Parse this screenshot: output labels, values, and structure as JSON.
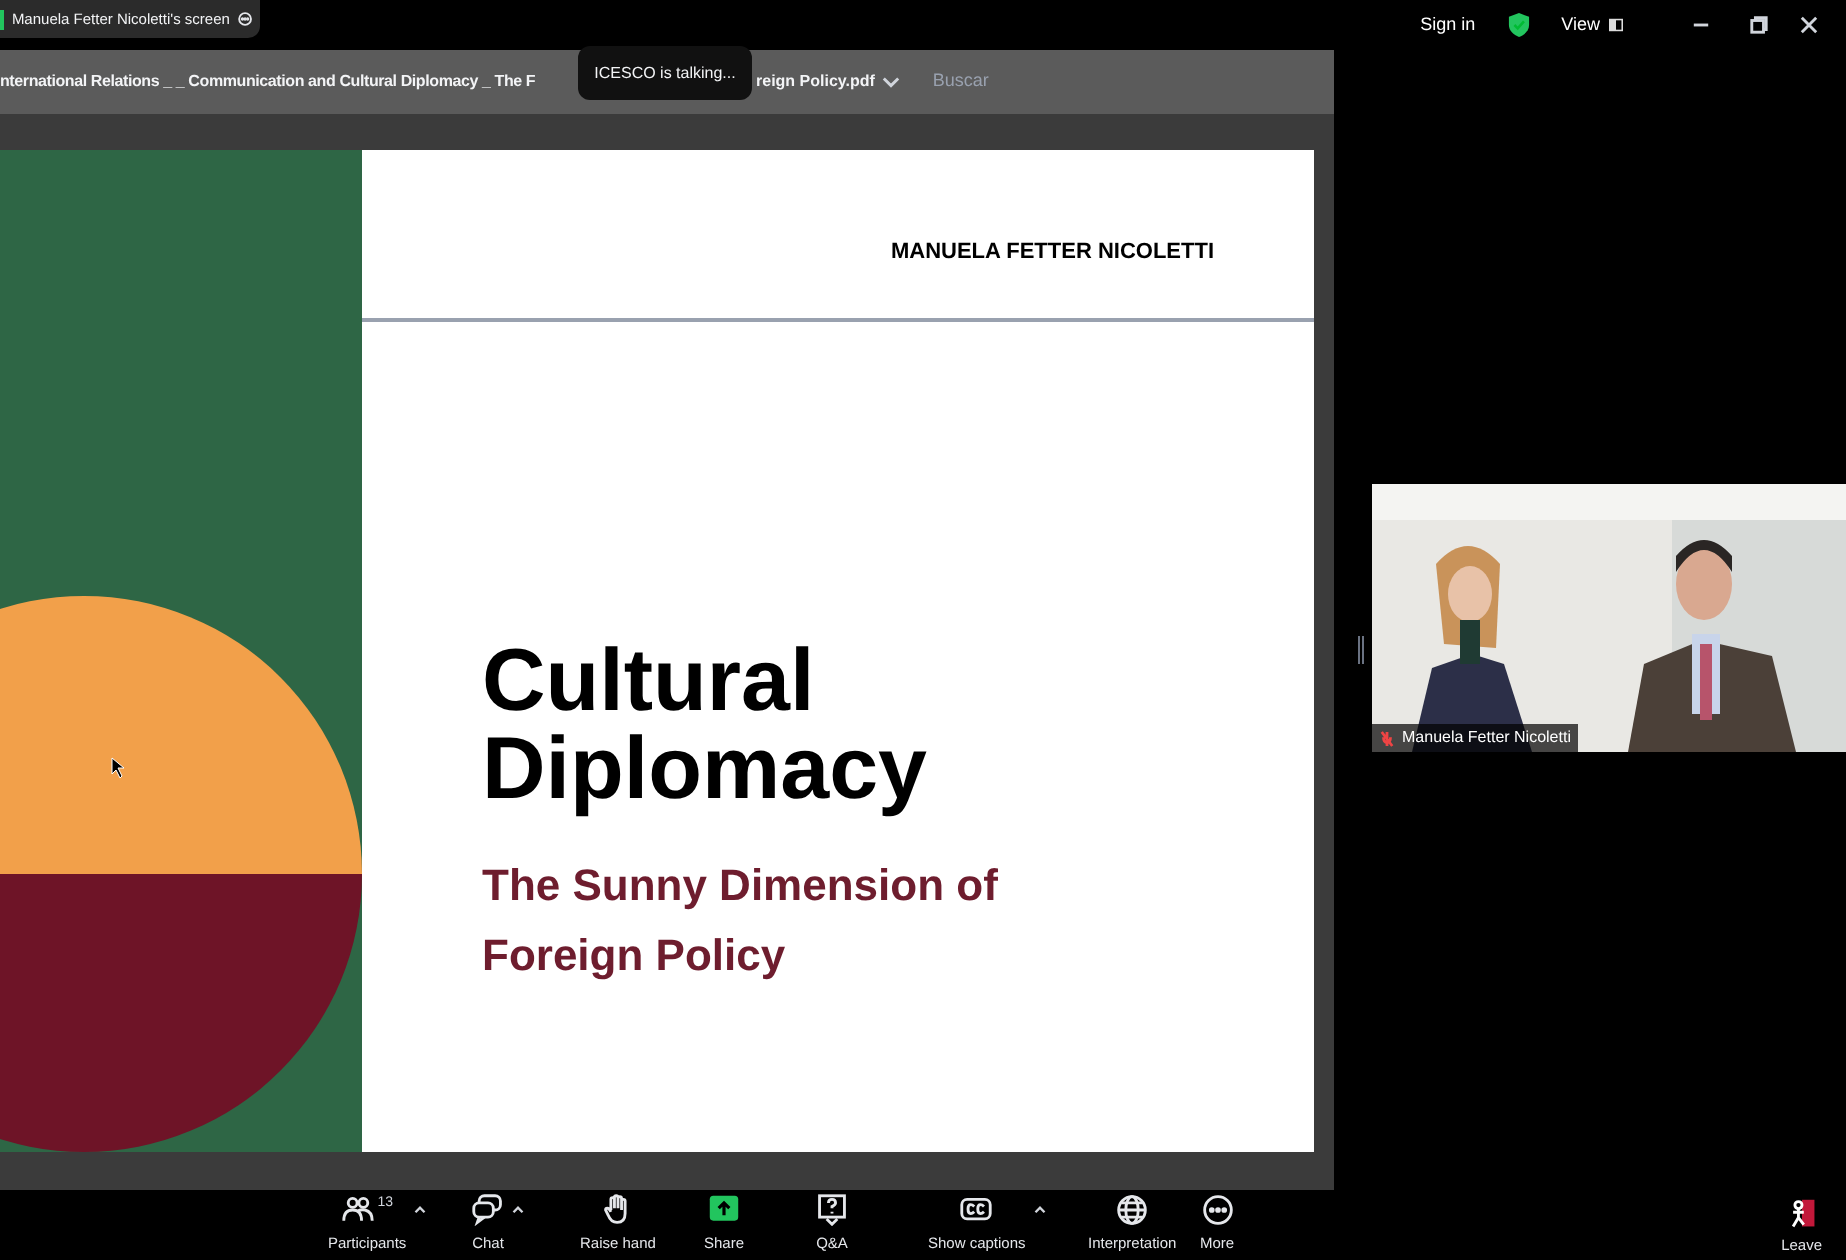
{
  "share_banner": {
    "label": "Manuela Fetter Nicoletti's screen"
  },
  "top_bar": {
    "sign_in": "Sign in",
    "view": "View"
  },
  "document": {
    "title_start": "nternational Relations _ _ Communication and Cultural Diplomacy _ The F",
    "title_end": "reign Policy.pdf",
    "search": {
      "placeholder": "Buscar"
    }
  },
  "tooltip": "ICESCO is talking...",
  "slide": {
    "author": "MANUELA FETTER NICOLETTI",
    "title": "Cultural Diplomacy",
    "subtitle": "The Sunny Dimension of Foreign Policy"
  },
  "video": {
    "name": "Manuela Fetter Nicoletti",
    "muted": true
  },
  "toolbar": [
    {
      "kind": "participants",
      "label": "Participants",
      "count": "13",
      "has_menu": true
    },
    {
      "kind": "chat",
      "label": "Chat",
      "has_menu": true
    },
    {
      "kind": "hand",
      "label": "Raise hand",
      "has_menu": false
    },
    {
      "kind": "share",
      "label": "Share",
      "has_menu": false
    },
    {
      "kind": "qa",
      "label": "Q&A",
      "has_menu": false
    },
    {
      "kind": "captions",
      "label": "Show captions",
      "has_menu": true
    },
    {
      "kind": "globe",
      "label": "Interpretation",
      "has_menu": false
    },
    {
      "kind": "more",
      "label": "More",
      "has_menu": false
    }
  ],
  "leave": {
    "label": "Leave"
  }
}
